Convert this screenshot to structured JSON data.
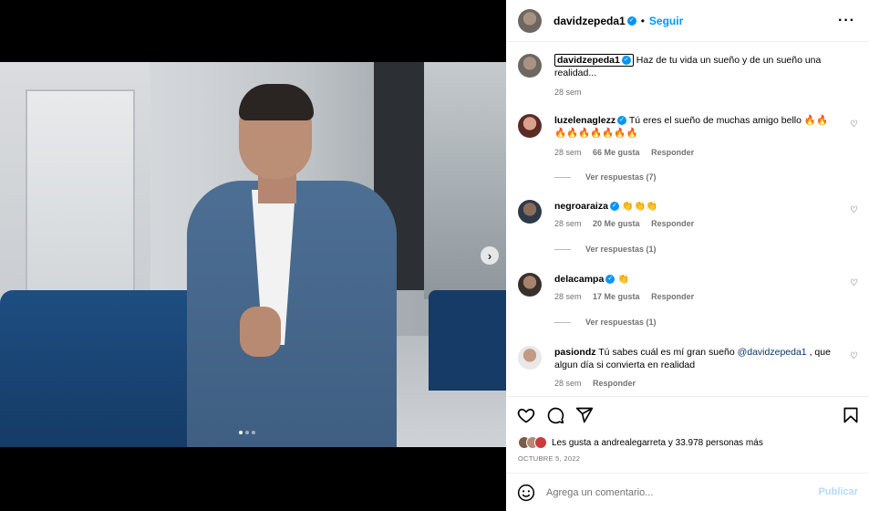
{
  "post": {
    "username": "davidzepeda1",
    "separator": "•",
    "follow_label": "Seguir",
    "more_label": "···",
    "caption": "Haz de tu vida un sueño y de un sueño una realidad...",
    "caption_time": "28 sem"
  },
  "comments": [
    {
      "username": "luzelenaglezz",
      "text": "Tú eres el sueño de muchas amigo bello 🔥🔥🔥🔥🔥🔥🔥🔥🔥",
      "time": "28 sem",
      "likes": "66 Me gusta",
      "reply_label": "Responder",
      "view_replies": "Ver respuestas (7)"
    },
    {
      "username": "negroaraiza",
      "text": "👏👏👏",
      "time": "28 sem",
      "likes": "20 Me gusta",
      "reply_label": "Responder",
      "view_replies": "Ver respuestas (1)"
    },
    {
      "username": "delacampa",
      "text": "👏",
      "time": "28 sem",
      "likes": "17 Me gusta",
      "reply_label": "Responder",
      "view_replies": "Ver respuestas (1)"
    },
    {
      "username": "pasiondz",
      "text_before": "Tú sabes cuál es mí gran sueño ",
      "mention": "@davidzepeda1",
      "text_after": " , que algun día si convierta en realidad",
      "time": "28 sem",
      "reply_label": "Responder"
    }
  ],
  "media": {
    "next_label": "›",
    "current_slide": 1,
    "total_slides": 3
  },
  "footer": {
    "likes_text": "Les gusta a andrealegarreta y 33.978 personas más",
    "date": "OCTUBRE 5, 2022",
    "comment_placeholder": "Agrega un comentario...",
    "publish_label": "Publicar"
  },
  "colors": {
    "accent": "#0095f6",
    "publish_disabled": "#b3dbff",
    "mention": "#00376b"
  }
}
